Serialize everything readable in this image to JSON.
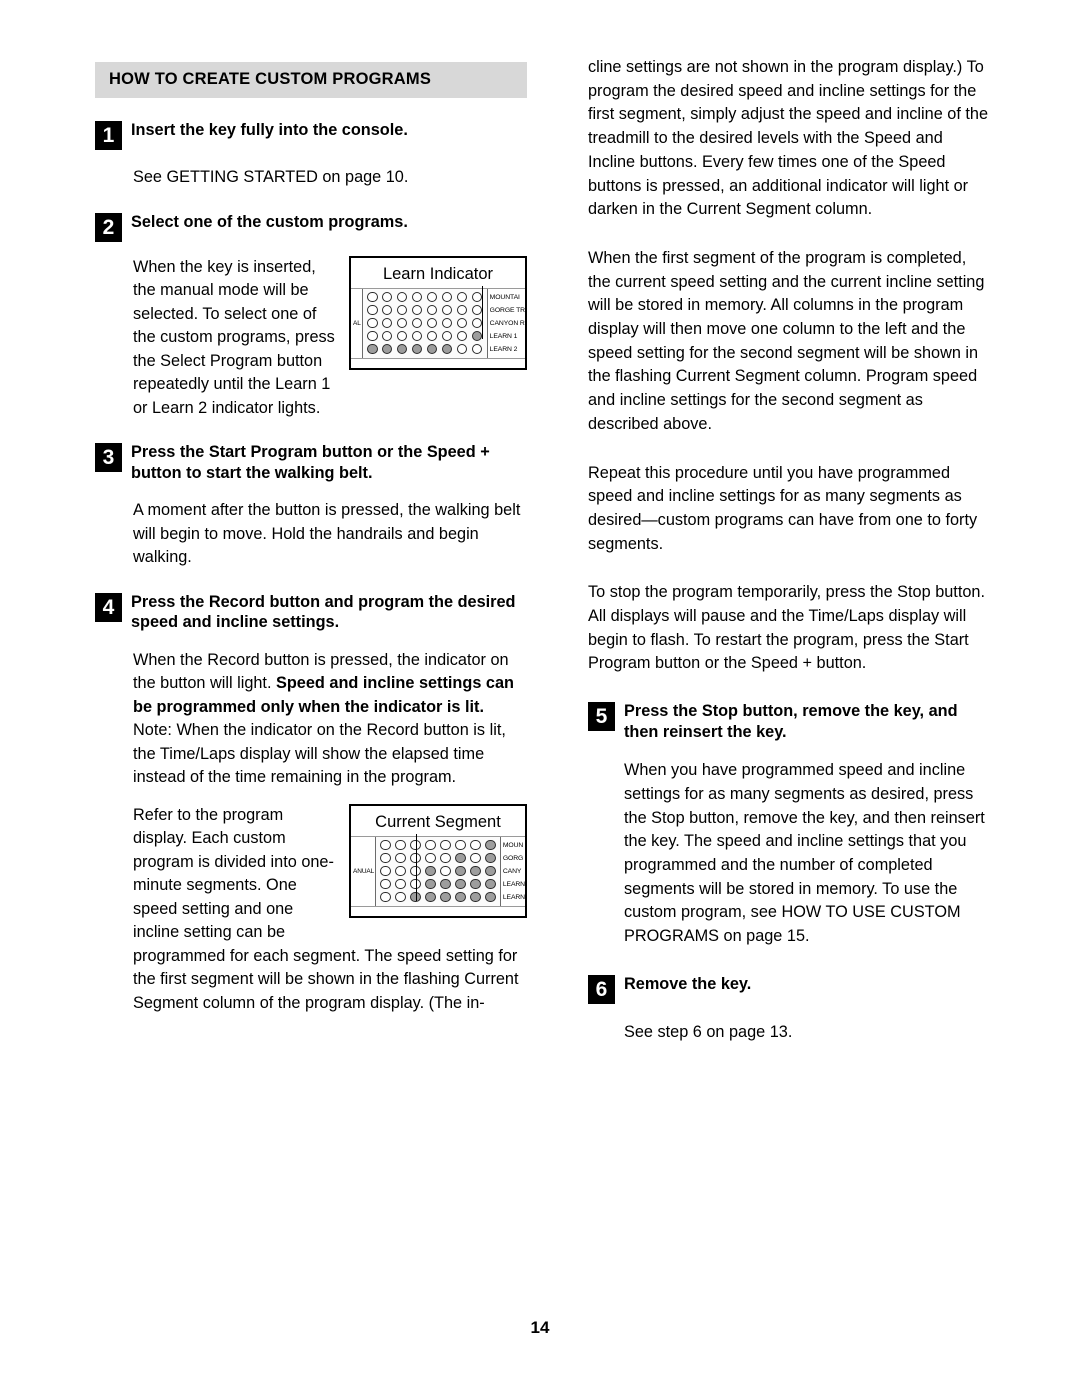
{
  "document": {
    "page_number": "14",
    "section_heading": "HOW TO CREATE CUSTOM PROGRAMS"
  },
  "left_column": {
    "steps": [
      {
        "number": "1",
        "title": "Insert the key fully into the console.",
        "body": "See GETTING STARTED on page 10."
      },
      {
        "number": "2",
        "title": "Select one of the custom programs.",
        "body_wrap": "When the key is inserted, the manual mode will be selected. To select one of the custom programs, press the Select Program button repeatedly until the Learn 1 or Learn 2 indicator lights."
      },
      {
        "number": "3",
        "title": "Press the Start Program button or the Speed + button to start the walking belt.",
        "body": "A moment after the button is pressed, the walking belt will begin to move. Hold the handrails and begin walking."
      },
      {
        "number": "4",
        "title": "Press the Record button and program the desired speed and incline settings.",
        "body_part1": "When the Record button is pressed, the indicator on the button will light. ",
        "body_bold": "Speed and incline settings can be programmed only when the indicator is lit.",
        "body_part2": " Note: When the indicator on the Record button is lit, the Time/Laps display will show the elapsed time instead of the time remaining in the program.",
        "body_wrap2": "Refer to the program display. Each custom program is divided into one-minute segments. One speed setting and one incline setting can be programmed for each segment. The speed setting for the first segment will be shown in the flashing Current Segment column of the program display. (The in-"
      }
    ]
  },
  "right_column": {
    "paragraphs": [
      "cline settings are not shown in the program display.) To program the desired speed and incline settings for the first segment, simply adjust the speed and incline of the treadmill to the desired levels with the Speed and Incline buttons. Every few times one of the Speed buttons is pressed, an additional indicator will light or darken in the Current Segment column.",
      "When the first segment of the program is completed, the current speed setting and the current incline setting will be stored in memory. All columns in the program display will then move one column to the left and the speed setting for the second segment will be shown in the flashing Current Segment column. Program speed and incline settings for the second segment as described above.",
      "Repeat this procedure until you have programmed speed and incline settings for as many segments as desired—custom programs can have from one to forty segments.",
      "To stop the program temporarily, press the Stop button. All displays will pause and the Time/Laps display will begin to flash. To restart the program, press the Start Program button or the Speed + button."
    ],
    "steps": [
      {
        "number": "5",
        "title": "Press the Stop button, remove the key, and then reinsert the key.",
        "body": "When you have programmed speed and incline settings for as many segments as desired, press the Stop button, remove the key, and then reinsert the key. The speed and incline settings that you programmed and the number of completed segments will be stored in memory. To use the custom program, see HOW TO USE CUSTOM PROGRAMS on page 15."
      },
      {
        "number": "6",
        "title": "Remove the key.",
        "body": "See step 6 on page 13."
      }
    ]
  },
  "figures": [
    {
      "id": "learn-indicator-figure",
      "caption": "Learn Indicator",
      "left_label": "AL",
      "right_labels": [
        "MOUNTAI",
        "GORGE TR",
        "CANYON R",
        "LEARN 1",
        "LEARN 2"
      ],
      "columns": 8,
      "rows": 5,
      "led_state": [
        [
          0,
          0,
          0,
          0,
          0,
          0,
          0,
          0
        ],
        [
          0,
          0,
          0,
          0,
          0,
          0,
          0,
          0
        ],
        [
          0,
          0,
          0,
          0,
          0,
          0,
          0,
          0
        ],
        [
          0,
          0,
          0,
          0,
          0,
          0,
          0,
          1
        ],
        [
          1,
          1,
          1,
          1,
          1,
          1,
          0,
          0
        ]
      ],
      "leader_column_index": 7
    },
    {
      "id": "current-segment-figure",
      "caption": "Current Segment",
      "left_label": "ANUAL",
      "right_labels": [
        "MOUN",
        "GORG",
        "CANY",
        "LEARN",
        "LEARN"
      ],
      "columns": 8,
      "rows": 5,
      "led_state": [
        [
          0,
          0,
          0,
          0,
          0,
          0,
          0,
          1
        ],
        [
          0,
          0,
          0,
          0,
          0,
          1,
          0,
          1
        ],
        [
          0,
          0,
          0,
          1,
          0,
          1,
          1,
          1
        ],
        [
          0,
          0,
          0,
          1,
          1,
          1,
          1,
          1
        ],
        [
          0,
          0,
          1,
          1,
          1,
          1,
          1,
          1
        ]
      ],
      "leader_column_index": 2
    }
  ],
  "colors": {
    "section_bar_bg": "#d8d8d8",
    "step_num_bg": "#000000",
    "led_on": "#9d9d9d",
    "led_off": "#ffffff"
  }
}
